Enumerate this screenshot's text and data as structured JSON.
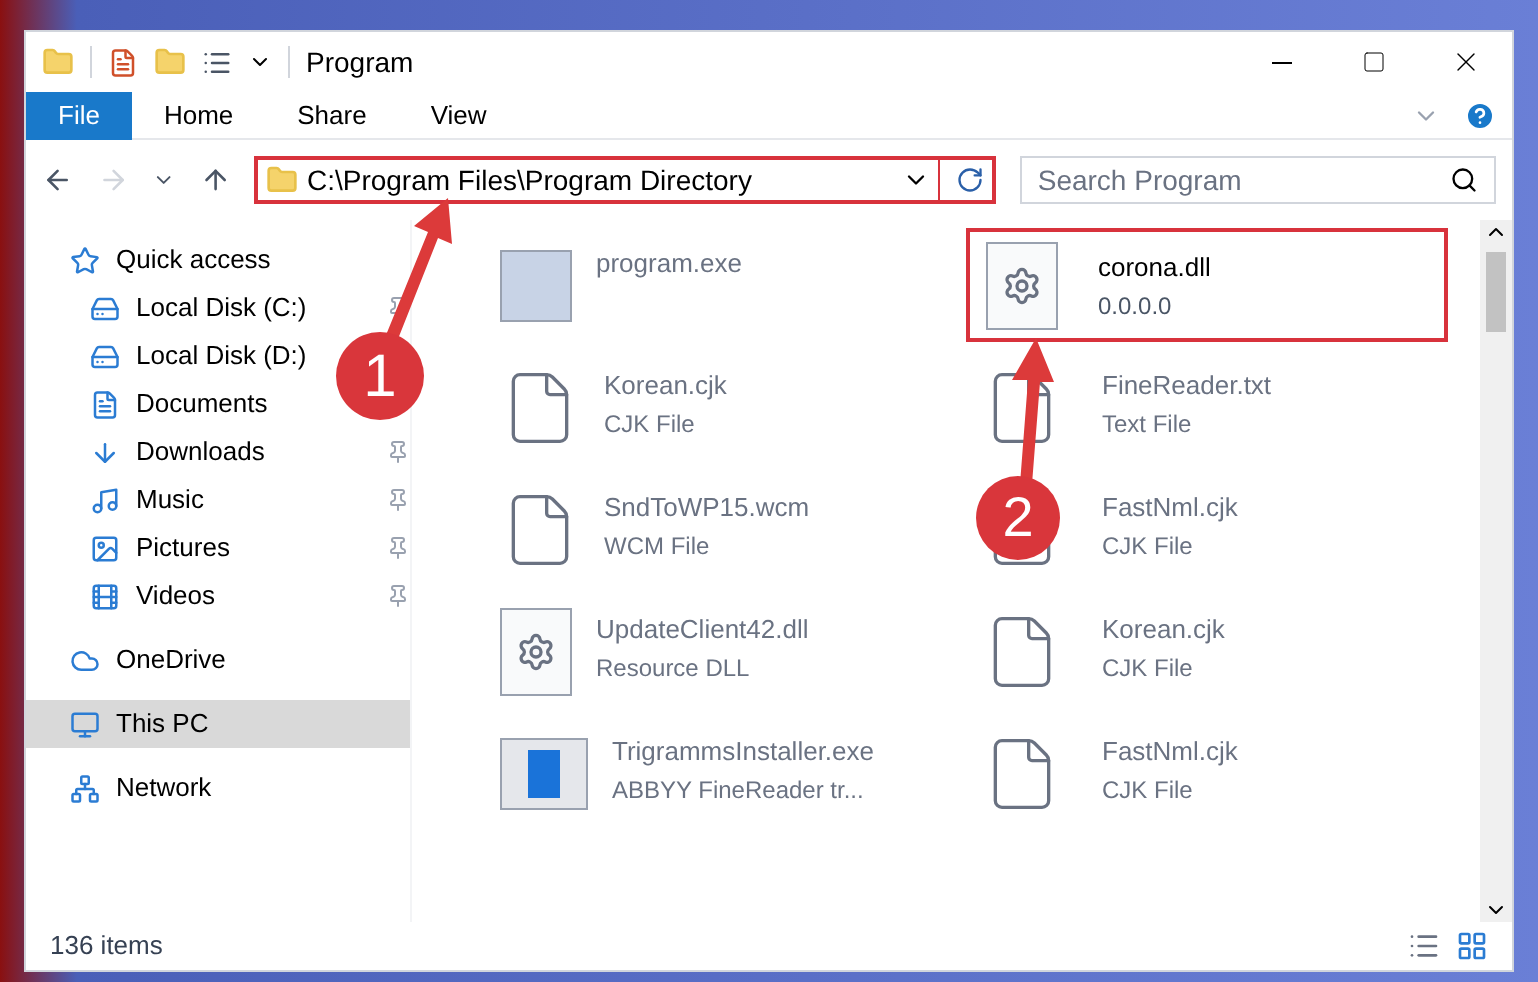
{
  "window": {
    "title": "Program"
  },
  "ribbon_tabs": [
    {
      "label": "File",
      "selected": true
    },
    {
      "label": "Home",
      "selected": false
    },
    {
      "label": "Share",
      "selected": false
    },
    {
      "label": "View",
      "selected": false
    }
  ],
  "address_bar": {
    "path": "C:\\Program Files\\Program Directory"
  },
  "search": {
    "placeholder": "Search Program"
  },
  "sidebar": {
    "items": [
      {
        "label": "Quick access",
        "kind": "section",
        "pinned": false,
        "selected": false
      },
      {
        "label": "Local Disk (C:)",
        "kind": "place",
        "pinned": true,
        "selected": false
      },
      {
        "label": "Local Disk (D:)",
        "kind": "place",
        "pinned": false,
        "selected": false
      },
      {
        "label": "Documents",
        "kind": "place",
        "pinned": false,
        "selected": false
      },
      {
        "label": "Downloads",
        "kind": "place",
        "pinned": true,
        "selected": false
      },
      {
        "label": "Music",
        "kind": "place",
        "pinned": true,
        "selected": false
      },
      {
        "label": "Pictures",
        "kind": "place",
        "pinned": true,
        "selected": false
      },
      {
        "label": "Videos",
        "kind": "place",
        "pinned": true,
        "selected": false
      },
      {
        "label": "OneDrive",
        "kind": "section",
        "pinned": false,
        "selected": false
      },
      {
        "label": "This PC",
        "kind": "section",
        "pinned": false,
        "selected": true
      },
      {
        "label": "Network",
        "kind": "section",
        "pinned": false,
        "selected": false
      }
    ]
  },
  "files": [
    {
      "name": "program.exe",
      "faded": true,
      "highlighted": false,
      "kind": "app"
    },
    {
      "name": "corona.dll",
      "detail": "0.0.0.0",
      "faded": false,
      "highlighted": true,
      "kind": "dll"
    },
    {
      "name": "Korean.cjk",
      "detail": "CJK File",
      "faded": true,
      "highlighted": false,
      "kind": "file"
    },
    {
      "name": "FineReader.txt",
      "detail": "Text File",
      "faded": true,
      "highlighted": false,
      "kind": "file"
    },
    {
      "name": "SndToWP15.wcm",
      "detail": "WCM File",
      "faded": true,
      "highlighted": false,
      "kind": "file"
    },
    {
      "name": "FastNml.cjk",
      "detail": "CJK File",
      "faded": true,
      "highlighted": false,
      "kind": "file"
    },
    {
      "name": "UpdateClient42.dll",
      "detail": "Resource DLL",
      "faded": true,
      "highlighted": false,
      "kind": "dll"
    },
    {
      "name": "Korean.cjk",
      "detail": "CJK File",
      "faded": true,
      "highlighted": false,
      "kind": "file"
    },
    {
      "name": "TrigrammsInstaller.exe",
      "detail": "ABBYY FineReader tr...",
      "faded": true,
      "highlighted": false,
      "kind": "installer"
    },
    {
      "name": "FastNml.cjk",
      "detail": "CJK File",
      "faded": true,
      "highlighted": false,
      "kind": "file"
    }
  ],
  "status_bar": {
    "count": "136 items"
  },
  "callouts": [
    "1",
    "2"
  ]
}
